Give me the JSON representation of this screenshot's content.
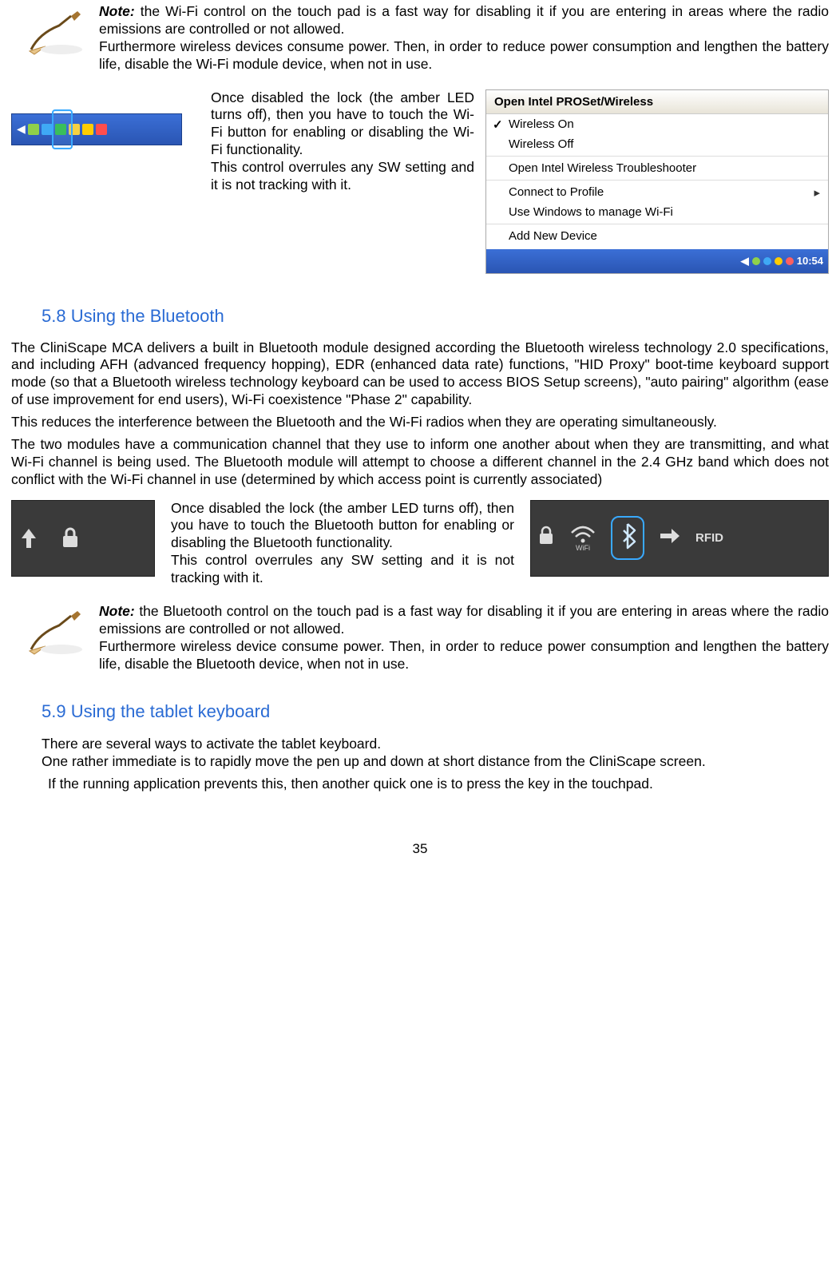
{
  "note1": {
    "label": "Note:",
    "line1": " the Wi-Fi control on the touch pad is a fast way for disabling it if you are entering in areas where the radio emissions are controlled or not allowed.",
    "line2": "Furthermore wireless devices consume power. Then, in order to reduce power consumption and lengthen the battery life, disable the Wi-Fi module device, when not in use."
  },
  "wifi_mid": {
    "p1": "Once disabled the lock (the amber LED turns off), then you have to touch the Wi-Fi button for enabling or disabling the Wi-Fi functionality.",
    "p2": "This control overrules any SW setting and it is not tracking with it."
  },
  "menu": {
    "title": "Open Intel PROSet/Wireless",
    "items": [
      "Wireless On",
      "Wireless Off",
      "Open Intel Wireless Troubleshooter",
      "Connect to Profile",
      "Use Windows to manage Wi-Fi",
      "Add New Device"
    ],
    "clock": "10:54"
  },
  "s58": {
    "heading": "5.8   Using  the Bluetooth",
    "p1": "The CliniScape MCA delivers a built in Bluetooth module designed according the Bluetooth wireless technology 2.0 specifications, and including AFH (advanced frequency hopping), EDR (enhanced data rate) functions, \"HID Proxy\" boot-time keyboard support mode (so that a Bluetooth wireless technology keyboard can be used to access BIOS Setup screens), \"auto pairing\" algorithm (ease of use improvement for end users), Wi-Fi coexistence \"Phase 2\" capability.",
    "p2": "This reduces the interference between the Bluetooth and the Wi-Fi radios when they are operating simultaneously.",
    "p3": "The two modules have a communication channel that they use to inform one another about when they are transmitting, and what Wi-Fi channel is being used. The Bluetooth module will attempt to choose a different channel in the 2.4 GHz band which does not conflict with the Wi-Fi channel in use (determined by which access point is currently associated)"
  },
  "bt_mid": {
    "p1": "Once disabled the lock (the amber LED turns off), then you have to touch the Bluetooth button for enabling or disabling the Bluetooth functionality.",
    "p2": "This control overrules any SW setting and it is not tracking with it."
  },
  "touchpad_label": "RFID",
  "note2": {
    "label": "Note:",
    "line1": " the Bluetooth control on the touch pad is a fast way for disabling it if you are entering in areas where the radio emissions are controlled or not allowed.",
    "line2": "Furthermore wireless device consume power. Then, in order to reduce power consumption and lengthen the battery life, disable the Bluetooth device, when not in use."
  },
  "s59": {
    "heading": "5.9   Using the tablet keyboard",
    "p1": "There are several ways to activate the tablet keyboard.",
    "p2": "One rather immediate is to rapidly move the pen up and down at short distance from the CliniScape screen.",
    "p3": "If the running application prevents this, then another quick one is to press the key in the touchpad."
  },
  "page_number": "35"
}
